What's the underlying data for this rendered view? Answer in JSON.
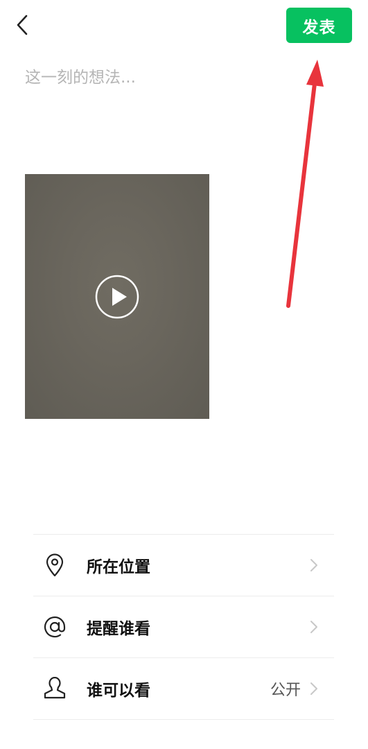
{
  "header": {
    "back_icon": "chevron-left-icon",
    "publish_label": "发表"
  },
  "composer": {
    "placeholder": "这一刻的想法...",
    "value": ""
  },
  "media": {
    "type": "video",
    "play_icon": "play-circle-icon"
  },
  "annotation": {
    "color": "#e8343c",
    "shape": "arrow"
  },
  "options": {
    "location": {
      "label": "所在位置",
      "icon": "location-pin-icon"
    },
    "mention": {
      "label": "提醒谁看",
      "icon": "at-sign-icon"
    },
    "visibility": {
      "label": "谁可以看",
      "value": "公开",
      "icon": "person-icon"
    }
  },
  "colors": {
    "accent": "#07c160",
    "placeholder": "#b5b5b5",
    "divider": "#ececec"
  }
}
